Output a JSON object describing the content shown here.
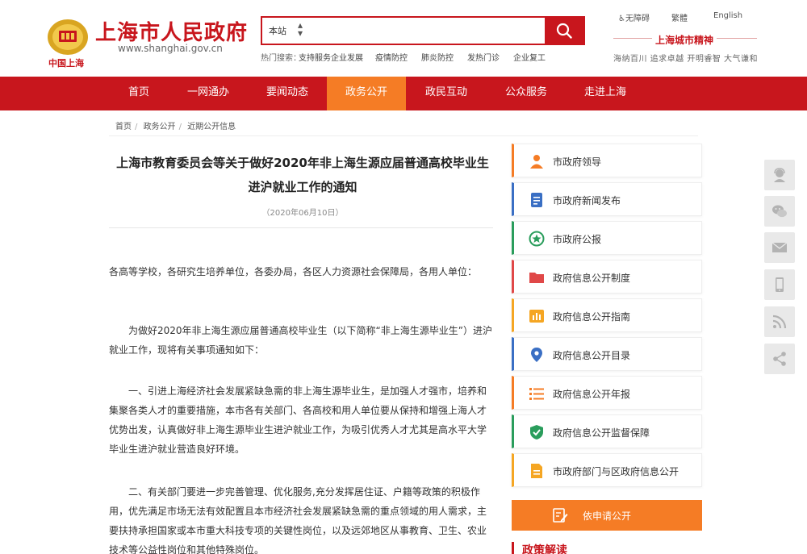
{
  "header": {
    "logo_subtitle": "中国上海",
    "site_title": "上海市人民政府",
    "site_url": "www.shanghai.gov.cn",
    "search": {
      "scope": "本站",
      "placeholder": "",
      "value": ""
    },
    "hot_label": "热门搜索：",
    "hot_items": [
      "支持服务企业发展",
      "疫情防控",
      "肺炎防控",
      "发热门诊",
      "企业复工"
    ],
    "links": {
      "accessible": "无障碍",
      "traditional": "繁體",
      "english": "English"
    },
    "spirit_title": "上海城市精神",
    "spirit_text": "海纳百川 追求卓越 开明睿智 大气谦和"
  },
  "nav": {
    "items": [
      "首页",
      "一网通办",
      "要闻动态",
      "政务公开",
      "政民互动",
      "公众服务",
      "走进上海"
    ],
    "active_index": 3
  },
  "breadcrumb": [
    "首页",
    "政务公开",
    "近期公开信息"
  ],
  "article": {
    "title": "上海市教育委员会等关于做好2020年非上海生源应届普通高校毕业生进沪就业工作的通知",
    "date": "（2020年06月10日）",
    "paragraphs": [
      "各高等学校，各研究生培养单位，各委办局，各区人力资源社会保障局，各用人单位：",
      "为做好2020年非上海生源应届普通高校毕业生（以下简称“非上海生源毕业生”）进沪就业工作，现将有关事项通知如下：",
      "一、引进上海经济社会发展紧缺急需的非上海生源毕业生，是加强人才强市，培养和集聚各类人才的重要措施，本市各有关部门、各高校和用人单位要从保持和增强上海人才优势出发，认真做好非上海生源毕业生进沪就业工作，为吸引优秀人才尤其是高水平大学毕业生进沪就业营造良好环境。",
      "二、有关部门要进一步完善管理、优化服务,充分发挥居住证、户籍等政策的积极作用，优先满足市场无法有效配置且本市经济社会发展紧缺急需的重点领域的用人需求，主要扶持承担国家或本市重大科技专项的关键性岗位，以及远郊地区从事教育、卫生、农业技术等公益性岗位和其他特殊岗位。"
    ]
  },
  "sidebar": {
    "items": [
      {
        "label": "市政府领导",
        "icon": "leader-icon",
        "color": "#f57c25"
      },
      {
        "label": "市政府新闻发布",
        "icon": "news-icon",
        "color": "#3a6fc4"
      },
      {
        "label": "市政府公报",
        "icon": "gazette-star-icon",
        "color": "#2a9d5c"
      },
      {
        "label": "政府信息公开制度",
        "icon": "folder-icon",
        "color": "#e04848"
      },
      {
        "label": "政府信息公开指南",
        "icon": "guide-chart-icon",
        "color": "#f5a623"
      },
      {
        "label": "政府信息公开目录",
        "icon": "location-pin-icon",
        "color": "#3a6fc4"
      },
      {
        "label": "政府信息公开年报",
        "icon": "list-icon",
        "color": "#f57c25"
      },
      {
        "label": "政府信息公开监督保障",
        "icon": "shield-icon",
        "color": "#2a9d5c"
      },
      {
        "label": "市政府部门与区政府信息公开",
        "icon": "document-icon",
        "color": "#f5a623"
      }
    ],
    "apply_label": "依申请公开",
    "policy_label": "政策解读"
  },
  "float_tools": [
    "customer-service-icon",
    "wechat-icon",
    "mail-icon",
    "mobile-icon",
    "rss-icon",
    "share-icon"
  ],
  "colors": {
    "brand_red": "#c8161d",
    "accent_orange": "#f57c25"
  }
}
